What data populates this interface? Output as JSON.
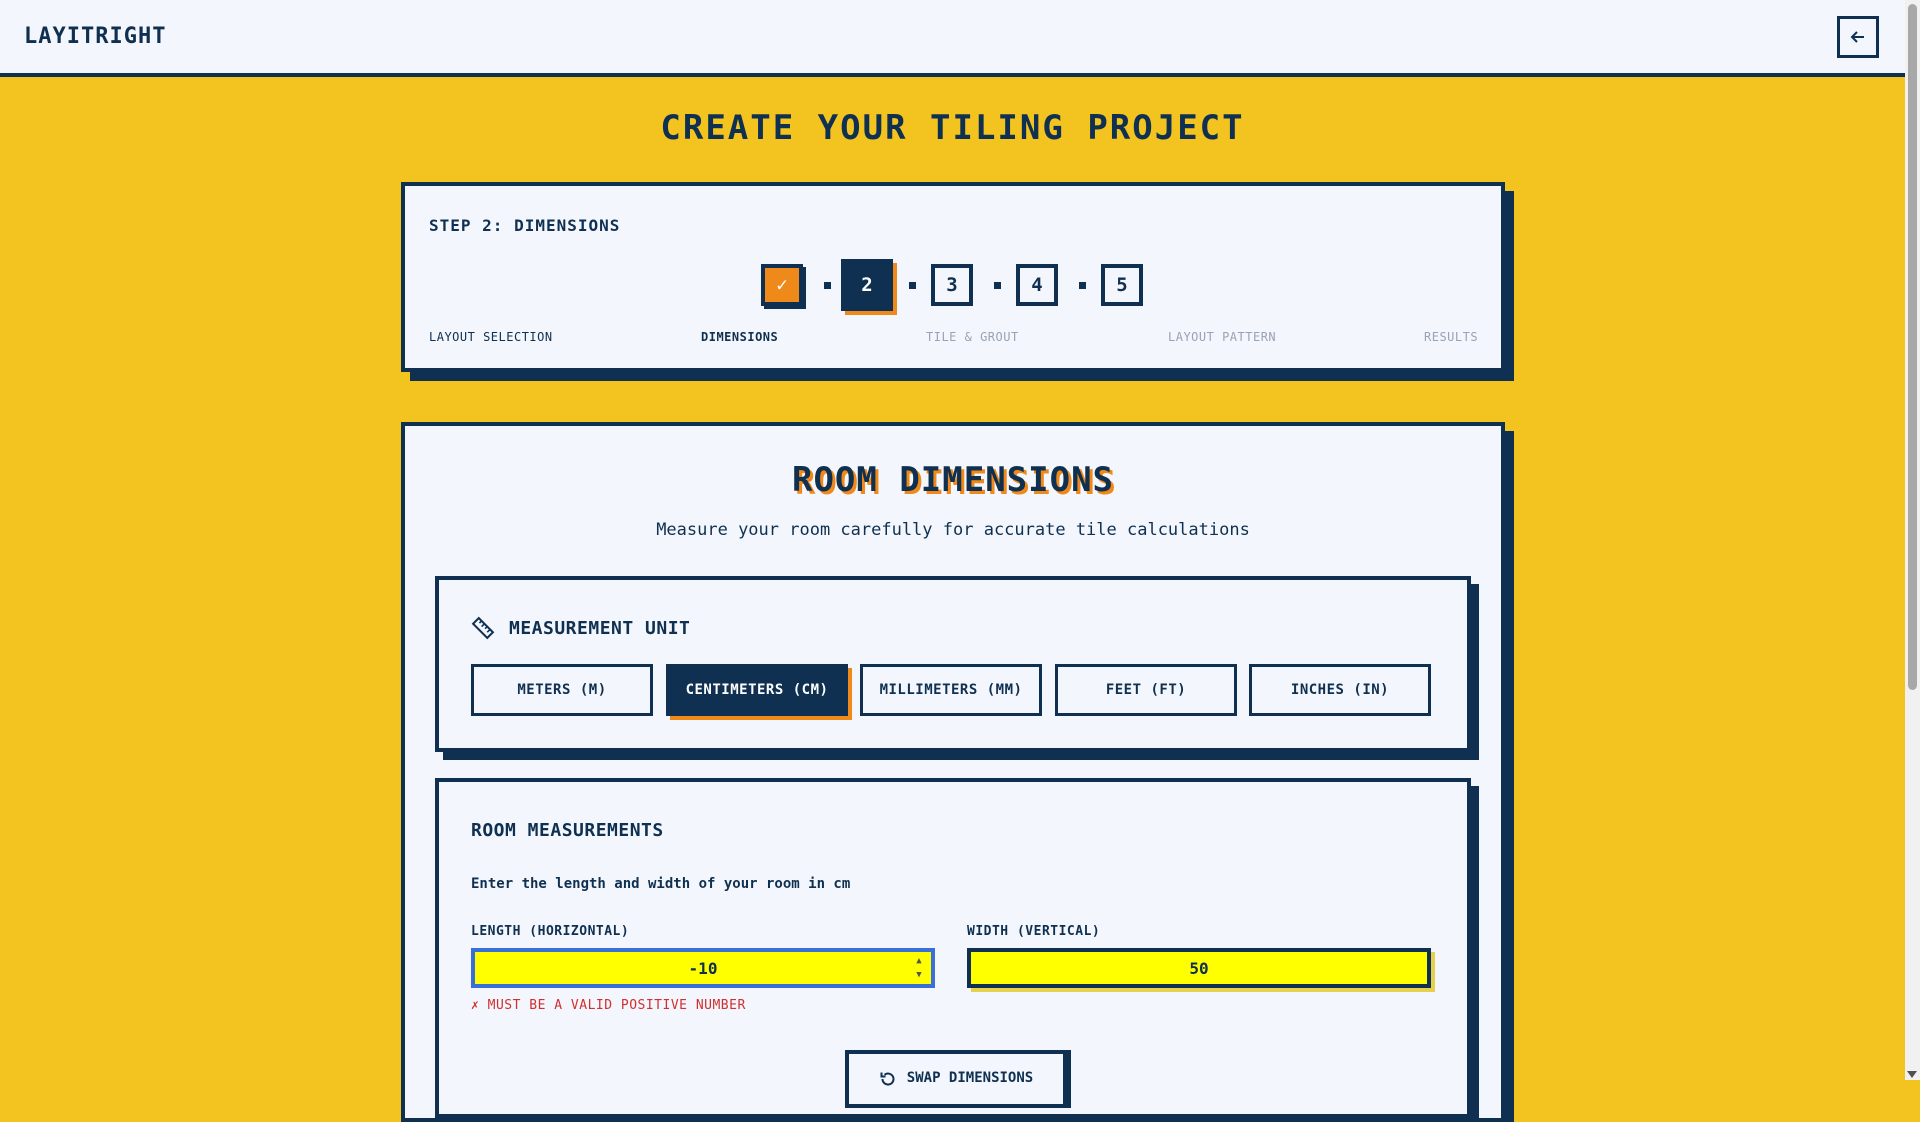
{
  "header": {
    "brand": "LAYITRIGHT"
  },
  "page": {
    "title": "CREATE YOUR TILING PROJECT"
  },
  "stepper": {
    "label": "STEP 2: DIMENSIONS",
    "steps": [
      {
        "number": "✓",
        "name": "LAYOUT SELECTION",
        "state": "done"
      },
      {
        "number": "2",
        "name": "DIMENSIONS",
        "state": "active"
      },
      {
        "number": "3",
        "name": "TILE & GROUT",
        "state": "upcoming"
      },
      {
        "number": "4",
        "name": "LAYOUT PATTERN",
        "state": "upcoming"
      },
      {
        "number": "5",
        "name": "RESULTS",
        "state": "upcoming"
      }
    ]
  },
  "room": {
    "title": "ROOM DIMENSIONS",
    "subtitle": "Measure your room carefully for accurate tile calculations"
  },
  "unit": {
    "heading": "MEASUREMENT UNIT",
    "options": [
      "METERS (M)",
      "CENTIMETERS (CM)",
      "MILLIMETERS (MM)",
      "FEET (FT)",
      "INCHES (IN)"
    ],
    "selected": "CENTIMETERS (CM)"
  },
  "measurements": {
    "heading": "ROOM MEASUREMENTS",
    "description": "Enter the length and width of your room in cm",
    "length_label": "LENGTH (HORIZONTAL)",
    "length_value": "-10",
    "width_label": "WIDTH (VERTICAL)",
    "width_value": "50",
    "error": "✗ MUST BE A VALID POSITIVE NUMBER",
    "swap_label": "SWAP DIMENSIONS"
  },
  "colors": {
    "navy": "#0f3050",
    "yellow": "#f3c41f",
    "orange": "#ef8a1a",
    "error": "#d0302f"
  }
}
